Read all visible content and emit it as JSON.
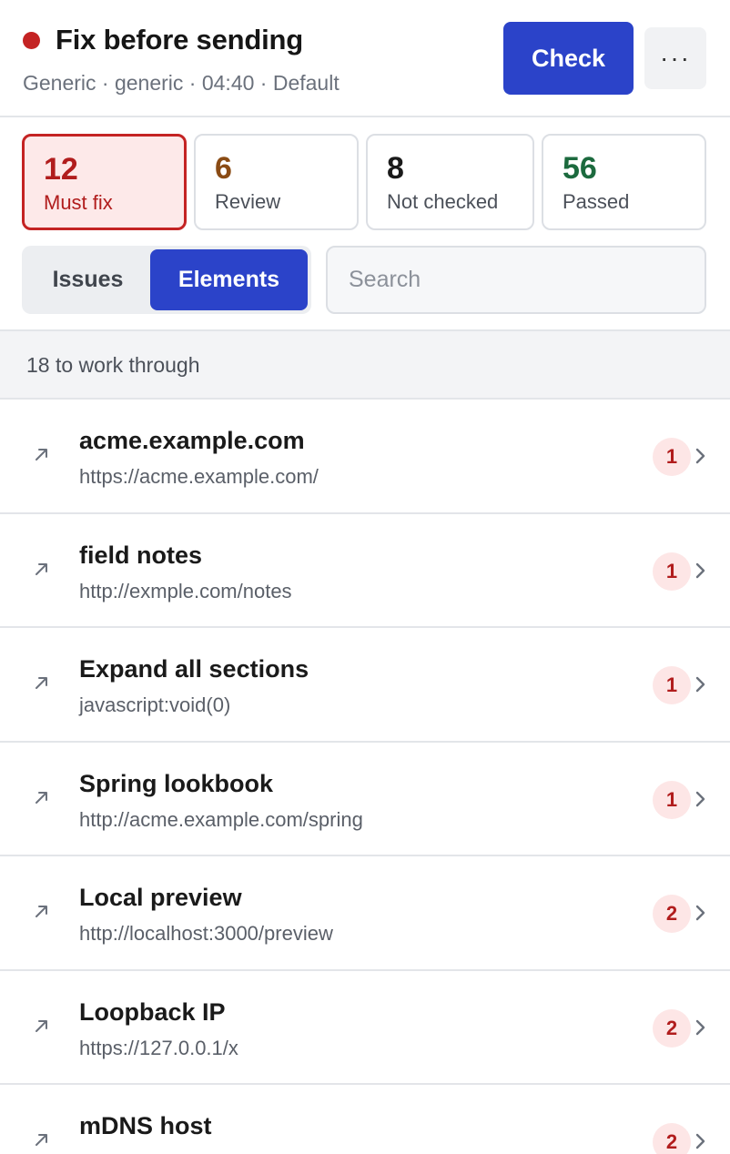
{
  "header": {
    "title": "Fix before sending",
    "meta": "Generic · generic · 04:40 · Default",
    "check_label": "Check",
    "more_label": "···",
    "status_color": "#c42323"
  },
  "stats": [
    {
      "value": "12",
      "label": "Must fix"
    },
    {
      "value": "6",
      "label": "Review"
    },
    {
      "value": "8",
      "label": "Not checked"
    },
    {
      "value": "56",
      "label": "Passed"
    }
  ],
  "tabs": {
    "issues": "Issues",
    "elements": "Elements",
    "selected": "Elements"
  },
  "search": {
    "placeholder": "Search",
    "value": ""
  },
  "list_summary": "18 to work through",
  "items": [
    {
      "name": "acme.example.com",
      "url": "https://acme.example.com/",
      "count": "1",
      "icon": "external-arrow-icon"
    },
    {
      "name": "field notes",
      "url": "http://exmple.com/notes",
      "count": "1",
      "icon": "external-arrow-icon"
    },
    {
      "name": "Expand all sections",
      "url": "javascript:void(0)",
      "count": "1",
      "icon": "external-arrow-icon"
    },
    {
      "name": "Spring lookbook",
      "url": "http://acme.example.com/spring",
      "count": "1",
      "icon": "external-arrow-icon"
    },
    {
      "name": "Local preview",
      "url": "http://localhost:3000/preview",
      "count": "2",
      "icon": "external-arrow-icon"
    },
    {
      "name": "Loopback IP",
      "url": "https://127.0.0.1/x",
      "count": "2",
      "icon": "external-arrow-icon"
    },
    {
      "name": "mDNS host",
      "url": "",
      "count": "2",
      "icon": "external-arrow-icon"
    }
  ],
  "colors": {
    "accent": "#2b43c9",
    "danger": "#c42323",
    "review": "#8a4b14",
    "passed": "#1c6a3e"
  }
}
